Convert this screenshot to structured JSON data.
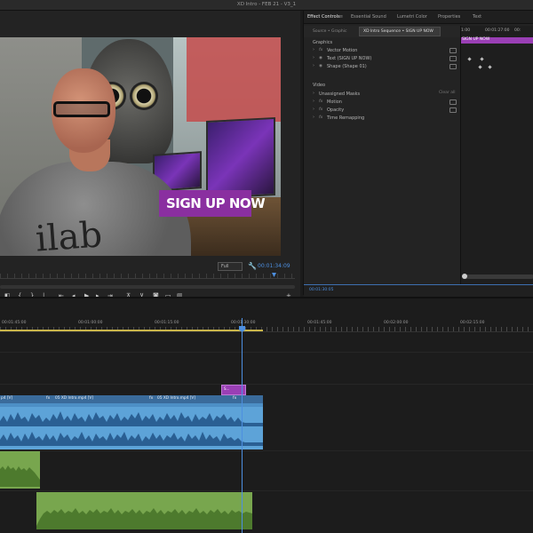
{
  "window": {
    "title": "XD Intro - FEB 21 - V3_1"
  },
  "program_monitor": {
    "overlay_text": "SIGN UP NOW",
    "shirt_text": "ilab",
    "fit_option": "Full",
    "timecode": "00:01:34:09",
    "controls": [
      "mark-in",
      "mark-out",
      "go-to-in",
      "step-back",
      "play",
      "step-forward",
      "go-to-out",
      "lift",
      "extract",
      "export-frame",
      "button-editor",
      "add"
    ]
  },
  "effect_controls": {
    "tabs": [
      {
        "label": "Effect Controls",
        "active": true
      },
      {
        "label": "Essential Sound",
        "active": false
      },
      {
        "label": "Lumetri Color",
        "active": false
      },
      {
        "label": "Properties",
        "active": false
      },
      {
        "label": "Text",
        "active": false
      }
    ],
    "source_label": "Source • Graphic",
    "sequence_label": "XD Intro Sequence • SIGN UP NOW",
    "graphics_header": "Graphics",
    "graphics_rows": [
      "Vector Motion",
      "Text (SIGN UP NOW)",
      "Shape (Shape 01)"
    ],
    "video_header": "Video",
    "video_rows": [
      "Unassigned Masks",
      "Motion",
      "Opacity",
      "Time Remapping"
    ],
    "clear_label": "Clear all",
    "timeline_ticks": [
      "1:00",
      "00:01:27:00",
      "00:"
    ],
    "clip_label": "SIGN UP NOW",
    "footer_timecode": "00:01:30:05"
  },
  "timeline": {
    "ruler": [
      "00:01:45:00",
      "00:01:00:00",
      "00:01:15:00",
      "00:01:30:00",
      "00:01:45:00",
      "00:02:00:00",
      "00:02:15:00"
    ],
    "graphic_clip": "S...",
    "video_clips": [
      "p4 [V]",
      "05 XD Intro.mp4 [V]",
      "05 XD Intro.mp4 [V]"
    ]
  },
  "colors": {
    "accent": "#4d8fe0",
    "graphic_clip": "#9a3fb5",
    "video_clip": "#3a6b9b",
    "audio_clip": "#5da3d8",
    "music_clip": "#78a64e"
  }
}
